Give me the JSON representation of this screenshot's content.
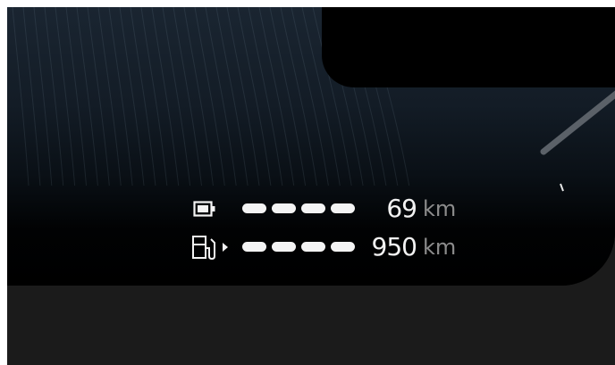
{
  "range": {
    "battery": {
      "value": "69",
      "unit": "km",
      "bar_count": 4,
      "icon": "battery-icon"
    },
    "fuel": {
      "value": "950",
      "unit": "km",
      "bar_count": 4,
      "icon": "fuel-pump-icon"
    }
  },
  "colors": {
    "text_primary": "#f2f2f2",
    "text_unit": "#8c8c8c",
    "background_top": "#1a2531",
    "background_bottom": "#000000",
    "frame": "#1b1b1b"
  }
}
